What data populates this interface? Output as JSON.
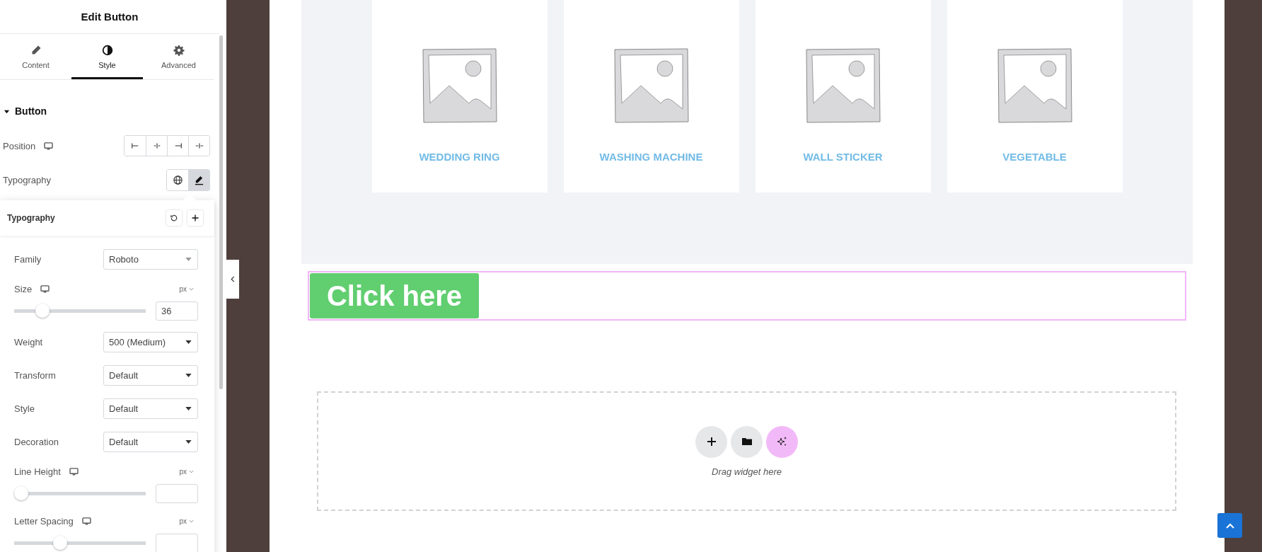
{
  "panel": {
    "title": "Edit Button",
    "tabs": [
      {
        "label": "Content",
        "selected": false
      },
      {
        "label": "Style",
        "selected": true
      },
      {
        "label": "Advanced",
        "selected": false
      }
    ],
    "section": {
      "title": "Button",
      "expanded": true
    },
    "position": {
      "label": "Position"
    },
    "typography": {
      "label": "Typography",
      "buttons": [
        {
          "selected": false
        },
        {
          "selected": true
        }
      ]
    },
    "popover": {
      "title": "Typography",
      "controls": [
        {
          "kind": "select",
          "label": "Family",
          "value": "Roboto"
        },
        {
          "kind": "slider",
          "label": "Size",
          "unit": "px",
          "level": 0.18,
          "value": "36"
        },
        {
          "kind": "select",
          "label": "Weight",
          "value": "500 (Medium)"
        },
        {
          "kind": "select",
          "label": "Transform",
          "value": "Default"
        },
        {
          "kind": "select",
          "label": "Style",
          "value": "Default"
        },
        {
          "kind": "select",
          "label": "Decoration",
          "value": "Default"
        },
        {
          "kind": "slider",
          "label": "Line Height",
          "unit": "px",
          "level": 0
        },
        {
          "kind": "slider",
          "label": "Letter Spacing",
          "unit": "px",
          "level": 0.33
        }
      ]
    }
  },
  "canvas": {
    "products": [
      {
        "name": "WEDDING RING"
      },
      {
        "name": "WASHING MACHINE"
      },
      {
        "name": "WALL STICKER"
      },
      {
        "name": "VEGETABLE"
      }
    ],
    "button": {
      "label": "Click here"
    },
    "drop_zone": {
      "text": "Drag widget here"
    }
  }
}
